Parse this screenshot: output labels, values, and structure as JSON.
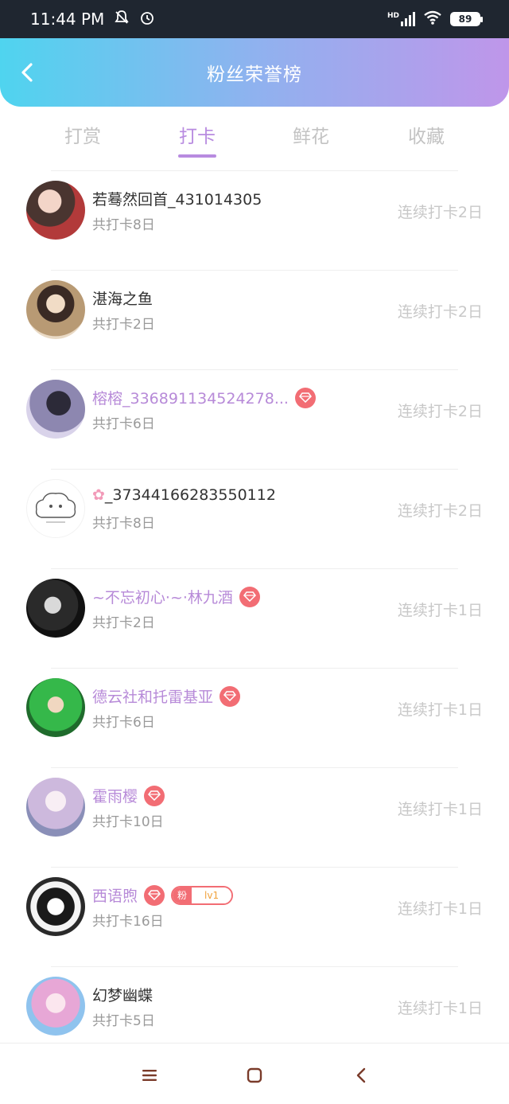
{
  "status_bar": {
    "time": "11:44 PM",
    "network": "HD",
    "battery": "89"
  },
  "header": {
    "title": "粉丝荣誉榜"
  },
  "tabs": [
    {
      "label": "打赏",
      "active": false
    },
    {
      "label": "打卡",
      "active": true
    },
    {
      "label": "鲜花",
      "active": false
    },
    {
      "label": "收藏",
      "active": false
    }
  ],
  "fans": [
    {
      "name": "若蓦然回首_431014305",
      "total": "共打卡8日",
      "streak": "连续打卡2日",
      "vip": false
    },
    {
      "name": "湛海之鱼",
      "total": "共打卡2日",
      "streak": "连续打卡2日",
      "vip": false
    },
    {
      "name": "榕榕_336891134524278...",
      "total": "共打卡6日",
      "streak": "连续打卡2日",
      "vip": true
    },
    {
      "name": "_37344166283550112",
      "total": "共打卡8日",
      "streak": "连续打卡2日",
      "vip": false
    },
    {
      "name": "~不忘初心·~·林九酒",
      "total": "共打卡2日",
      "streak": "连续打卡1日",
      "vip": true
    },
    {
      "name": "德云社和托雷基亚",
      "total": "共打卡6日",
      "streak": "连续打卡1日",
      "vip": true
    },
    {
      "name": "霍雨樱",
      "total": "共打卡10日",
      "streak": "连续打卡1日",
      "vip": true
    },
    {
      "name": "西语煦",
      "total": "共打卡16日",
      "streak": "连续打卡1日",
      "vip": true,
      "fan_badge": {
        "label": "粉",
        "level": "lv1"
      }
    },
    {
      "name": "幻梦幽蝶",
      "total": "共打卡5日",
      "streak": "连续打卡1日",
      "vip": false
    }
  ],
  "colors": {
    "accent": "#b88be0",
    "vip_name": "#b78ad8",
    "badge": "#f26d74"
  }
}
